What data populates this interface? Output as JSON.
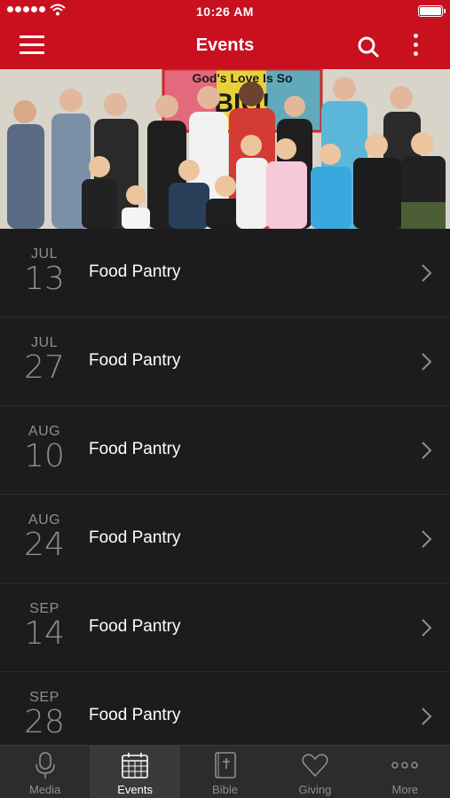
{
  "status_bar": {
    "time": "10:26 AM"
  },
  "nav": {
    "title": "Events"
  },
  "header_photo": {
    "banner_text_line1": "God's Love Is So",
    "banner_text_line2": "BIG!"
  },
  "events": [
    {
      "month": "JUL",
      "day": "13",
      "name": "Food Pantry"
    },
    {
      "month": "JUL",
      "day": "27",
      "name": "Food Pantry"
    },
    {
      "month": "AUG",
      "day": "10",
      "name": "Food Pantry"
    },
    {
      "month": "AUG",
      "day": "24",
      "name": "Food Pantry"
    },
    {
      "month": "SEP",
      "day": "14",
      "name": "Food Pantry"
    },
    {
      "month": "SEP",
      "day": "28",
      "name": "Food Pantry"
    }
  ],
  "tabs": [
    {
      "label": "Media",
      "icon": "microphone-icon",
      "active": false
    },
    {
      "label": "Events",
      "icon": "calendar-icon",
      "active": true
    },
    {
      "label": "Bible",
      "icon": "bible-icon",
      "active": false
    },
    {
      "label": "Giving",
      "icon": "heart-icon",
      "active": false
    },
    {
      "label": "More",
      "icon": "more-dots-icon",
      "active": false
    }
  ],
  "colors": {
    "brand_red": "#c8101f",
    "background": "#1c1c1e",
    "text_muted": "#8e8e93"
  }
}
